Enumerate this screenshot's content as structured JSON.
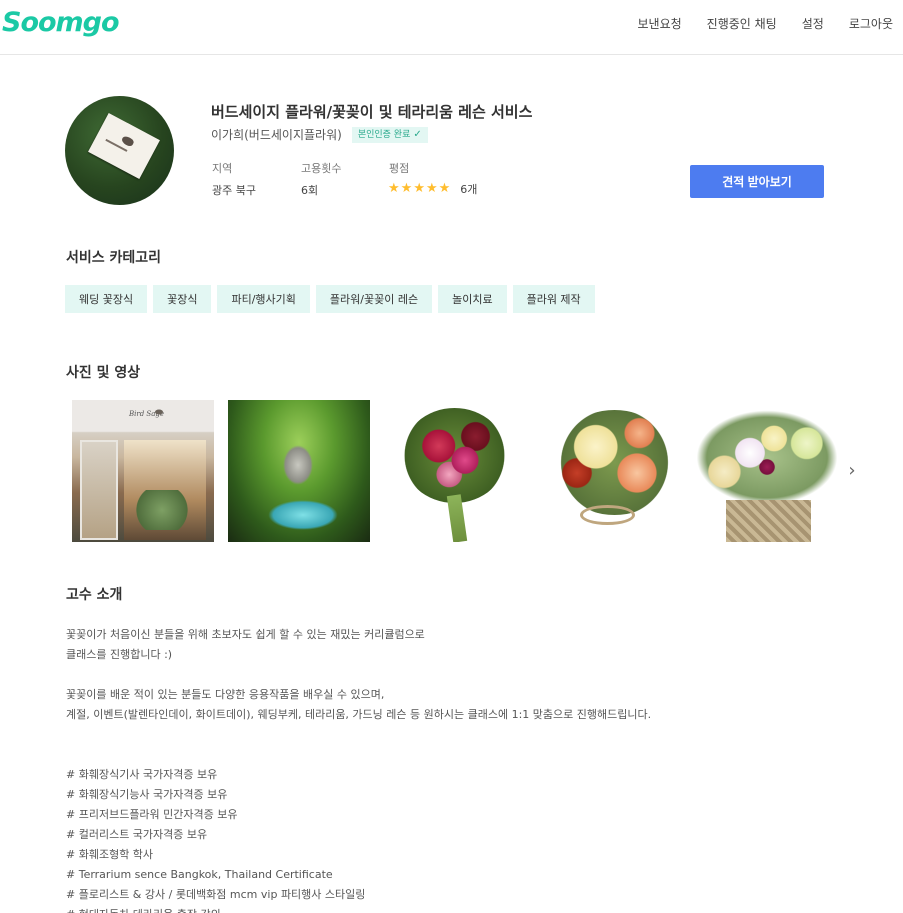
{
  "header": {
    "logo": "Soomgo",
    "nav": [
      "보낸요청",
      "진행중인 채팅",
      "설정",
      "로그아웃"
    ]
  },
  "profile": {
    "title": "버드세이지 플라워/꽃꽂이 및 테라리움 레슨 서비스",
    "name": "이가희(버드세이지플라워)",
    "verified_label": "본인인증 완료",
    "stats": {
      "region_label": "지역",
      "region_value": "광주 북구",
      "hire_label": "고용횟수",
      "hire_value": "6회",
      "rating_label": "평점",
      "rating_stars": 5,
      "rating_count": "6개"
    },
    "quote_button": "견적 받아보기"
  },
  "categories": {
    "title": "서비스 카테고리",
    "items": [
      "웨딩 꽃장식",
      "꽃장식",
      "파티/행사기획",
      "플라워/꽃꽂이 레슨",
      "놀이치료",
      "플라워 제작"
    ]
  },
  "media": {
    "title": "사진 및 영상",
    "photo_sign_text": "Bird Sage"
  },
  "intro": {
    "title": "고수 소개",
    "paragraph1": [
      "꽃꽂이가 처음이신 분들을 위해 초보자도 쉽게 할 수 있는 재밌는 커리큘럼으로",
      "클래스를 진행합니다 :)"
    ],
    "paragraph2": [
      "꽃꽂이를 배운 적이 있는 분들도 다양한 응용작품을 배우실 수 있으며,",
      "계절, 이벤트(발렌타인데이, 화이트데이), 웨딩부케, 테라리움, 가드닝 레슨 등 원하시는 클래스에 1:1 맞춤으로 진행해드립니다."
    ],
    "credentials": [
      "# 화훼장식기사 국가자격증 보유",
      "# 화훼장식기능사 국가자격증 보유",
      "# 프리저브드플라워 민간자격증 보유",
      "# 컬러리스트 국가자격증 보유",
      "# 화훼조형학 학사",
      "# Terrarium sence Bangkok, Thailand Certificate",
      "# 플로리스트 & 강사 / 롯데백화점 mcm vip 파티행사 스타일링",
      "# 현대자동차 테라리움 출장 강의"
    ]
  },
  "colors": {
    "brand": "#1bc9a5",
    "primary_button": "#4d7cf0",
    "chip_bg": "#e3f7f3",
    "star": "#ffbd2e"
  }
}
